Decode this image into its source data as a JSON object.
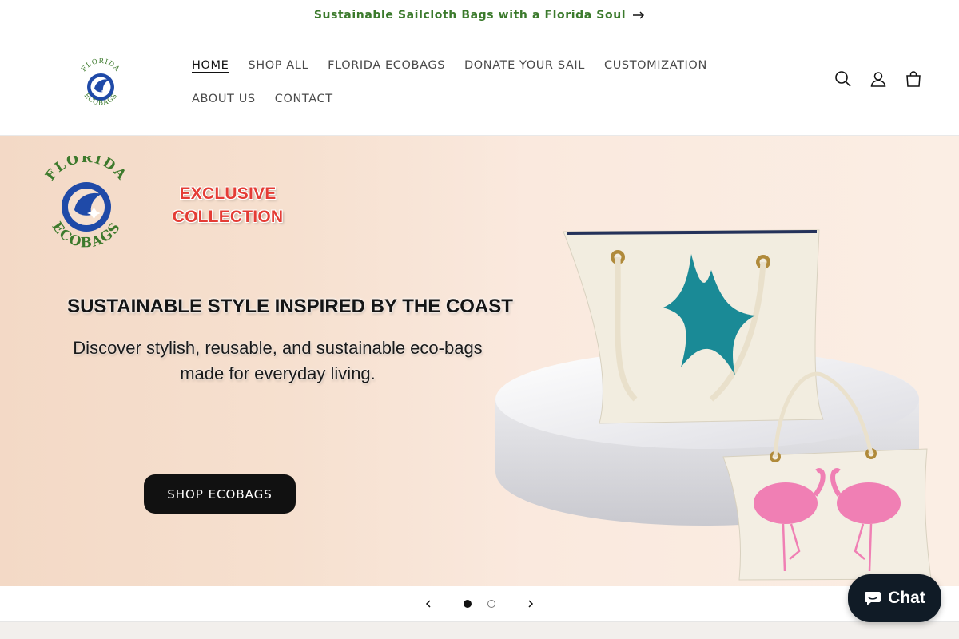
{
  "announcement": {
    "text": "Sustainable Sailcloth Bags with a Florida Soul",
    "color": "#3b7a2c"
  },
  "header": {
    "logo": {
      "name": "florida-ecobags-logo",
      "text_top": "FLORIDA",
      "text_bottom": "ECOBAGS"
    },
    "nav": [
      {
        "label": "HOME",
        "active": true
      },
      {
        "label": "SHOP ALL",
        "active": false
      },
      {
        "label": "FLORIDA ECOBAGS",
        "active": false
      },
      {
        "label": "DONATE YOUR SAIL",
        "active": false
      },
      {
        "label": "CUSTOMIZATION",
        "active": false
      },
      {
        "label": "ABOUT US",
        "active": false
      },
      {
        "label": "CONTACT",
        "active": false
      }
    ],
    "icons": [
      "search-icon",
      "account-icon",
      "cart-icon"
    ]
  },
  "hero": {
    "logo_text_top": "FLORIDA",
    "logo_text_bottom": "ECOBAGS",
    "exclusive": [
      "EXCLUSIVE",
      "COLLECTION"
    ],
    "title": "SUSTAINABLE STYLE INSPIRED BY THE COAST",
    "subtitle_lines": [
      "Discover stylish, reusable, and sustainable eco-bags",
      "made for everyday living."
    ],
    "button": "SHOP ECOBAGS",
    "colors": {
      "brand_blue": "#1f4aa8",
      "brand_green": "#3d7a2c",
      "accent_red": "#e43c35",
      "starfish": "#1a8a96",
      "flamingo": "#f07fb4"
    }
  },
  "slider": {
    "current": 1,
    "total": 2
  },
  "chat": {
    "label": "Chat",
    "background": "#101b26"
  }
}
